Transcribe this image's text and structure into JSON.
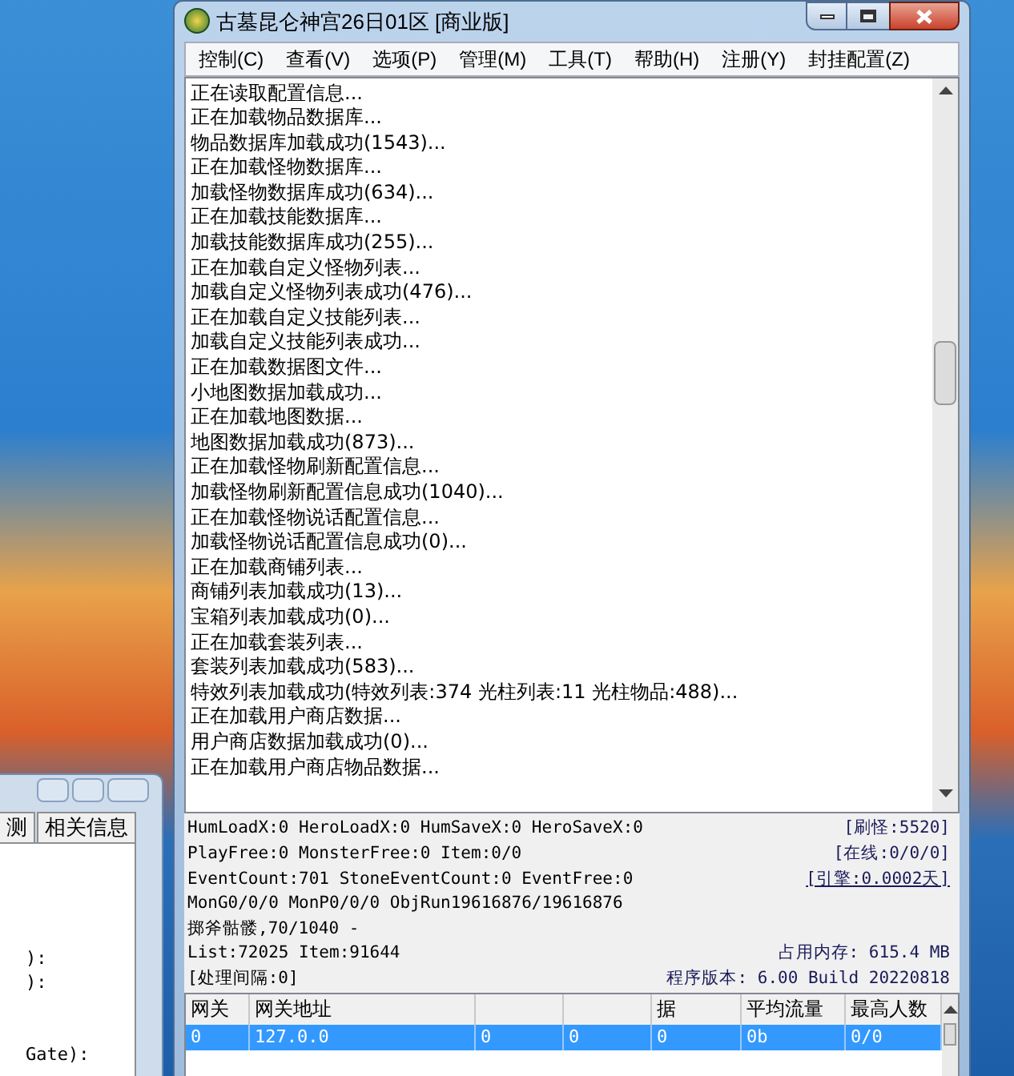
{
  "window": {
    "title": "古墓昆仑神宫26日01区 [商业版]"
  },
  "menu": [
    "控制(C)",
    "查看(V)",
    "选项(P)",
    "管理(M)",
    "工具(T)",
    "帮助(H)",
    "注册(Y)",
    "封挂配置(Z)"
  ],
  "log": [
    "正在读取配置信息...",
    "正在加载物品数据库...",
    "物品数据库加载成功(1543)...",
    "正在加载怪物数据库...",
    "加载怪物数据库成功(634)...",
    "正在加载技能数据库...",
    "加载技能数据库成功(255)...",
    "正在加载自定义怪物列表...",
    "加载自定义怪物列表成功(476)...",
    "正在加载自定义技能列表...",
    "加载自定义技能列表成功...",
    "正在加载数据图文件...",
    "小地图数据加载成功...",
    "正在加载地图数据...",
    "地图数据加载成功(873)...",
    "正在加载怪物刷新配置信息...",
    "加载怪物刷新配置信息成功(1040)...",
    "正在加载怪物说话配置信息...",
    "加载怪物说话配置信息成功(0)...",
    "正在加载商铺列表...",
    "商铺列表加载成功(13)...",
    "宝箱列表加载成功(0)...",
    "正在加载套装列表...",
    "套装列表加载成功(583)...",
    "特效列表加载成功(特效列表:374 光柱列表:11 光柱物品:488)...",
    "正在加载用户商店数据...",
    "用户商店数据加载成功(0)...",
    "正在加载用户商店物品数据..."
  ],
  "status": [
    {
      "left": "HumLoadX:0 HeroLoadX:0 HumSaveX:0 HeroSaveX:0",
      "right": "[刷怪:5520]",
      "underlined": false
    },
    {
      "left": "PlayFree:0 MonsterFree:0 Item:0/0",
      "right": "[在线:0/0/0]",
      "underlined": false
    },
    {
      "left": "EventCount:701 StoneEventCount:0 EventFree:0",
      "right": "[引擎:0.0002天]",
      "underlined": true
    },
    {
      "left": "MonG0/0/0 MonP0/0/0 ObjRun19616876/19616876"
    },
    {
      "left": "掷斧骷髅,70/1040 -"
    },
    {
      "left": "List:72025 Item:91644",
      "right": "占用内存: 615.4 MB",
      "underlined": false
    },
    {
      "left": "[处理间隔:0]",
      "right": "程序版本: 6.00 Build 20220818",
      "underlined": false
    }
  ],
  "table": {
    "columns": [
      {
        "label": "网关"
      },
      {
        "label": "网关地址"
      },
      {},
      {},
      {
        "label": "据"
      },
      {
        "label": "平均流量"
      },
      {
        "label": "最高人数"
      }
    ],
    "rows": [
      {
        "selected": true,
        "cells": [
          "0",
          "127.0.0",
          "0",
          "0",
          "0",
          "0b",
          "0/0"
        ]
      }
    ]
  },
  "second_window": {
    "tabs": [
      "测",
      "相关信息"
    ],
    "lines": [
      "):",
      "):",
      "Gate):"
    ]
  }
}
